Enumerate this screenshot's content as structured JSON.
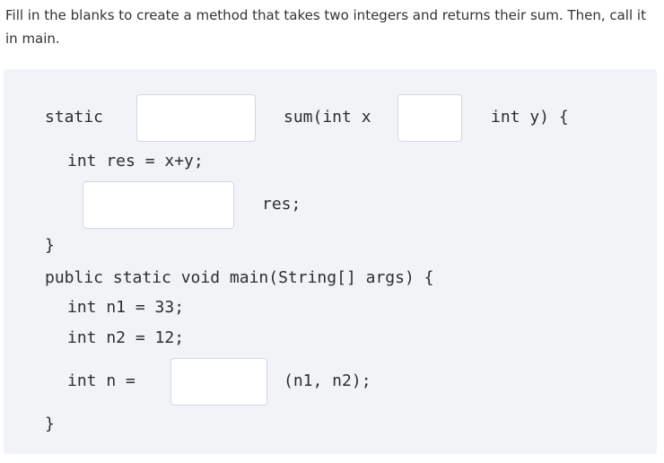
{
  "instructions": "Fill in the blanks to create a method that takes two integers and returns their sum. Then, call it in main.",
  "code": {
    "line1_static": "static",
    "line1_sum": "sum(int x",
    "line1_end": "int y) {",
    "line2": "int res = x+y;",
    "line3_res": "res;",
    "line4_close": "}",
    "line5": "public static void main(String[] args) {",
    "line6": "int n1 = 33;",
    "line7": "int n2 = 12;",
    "line8_intn": "int n =",
    "line8_args": "(n1, n2);",
    "line9_close": "}"
  },
  "blanks": {
    "return_type": "",
    "param_separator": "",
    "return_keyword": "",
    "method_call_name": ""
  }
}
